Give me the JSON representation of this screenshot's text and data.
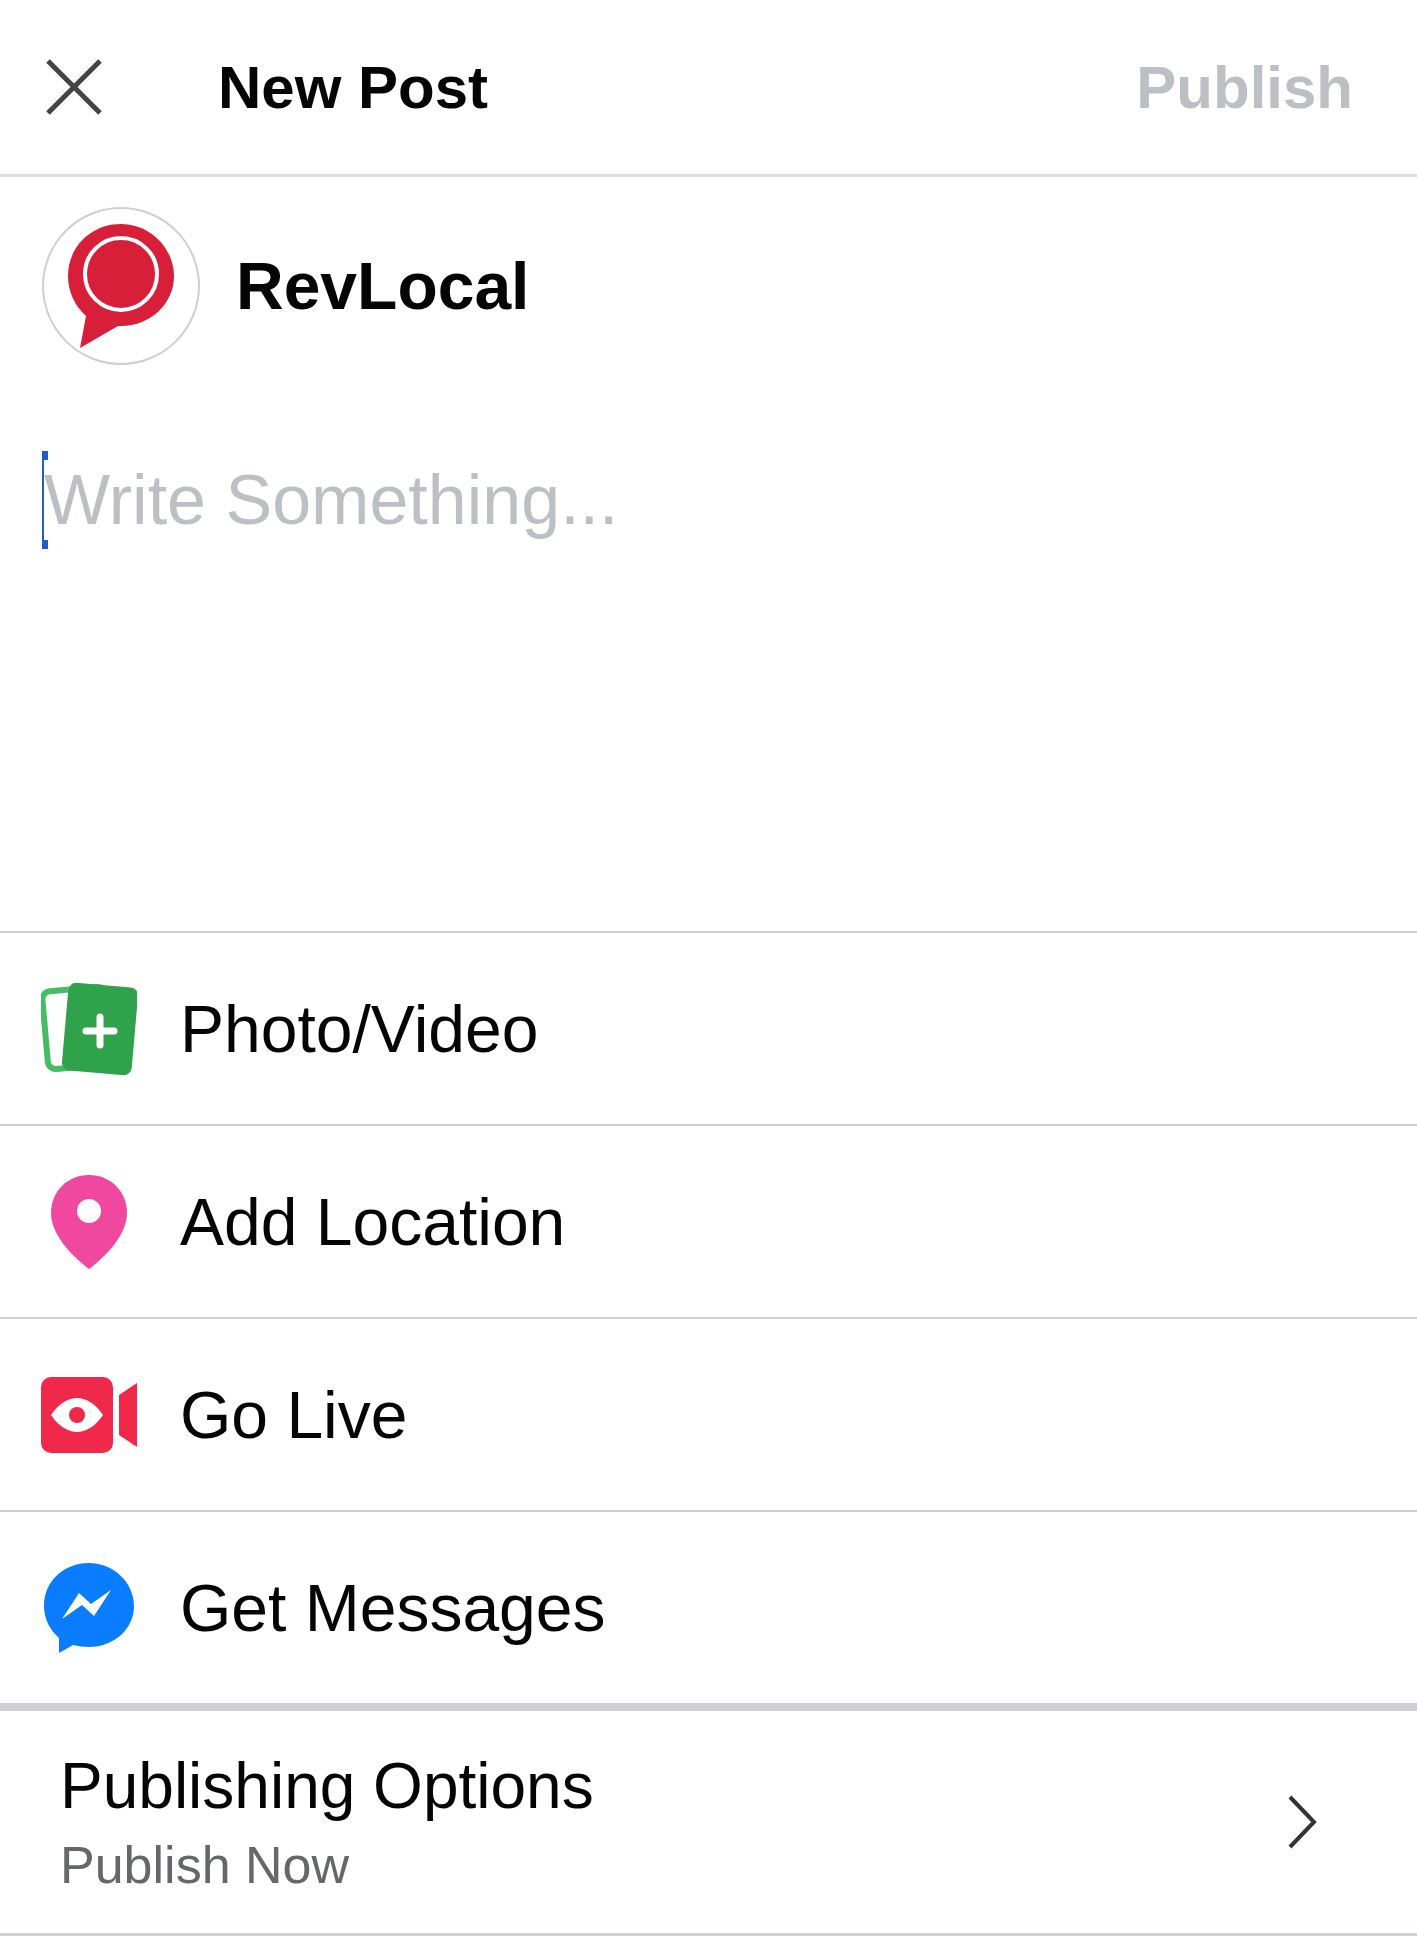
{
  "header": {
    "title": "New Post",
    "publish": {
      "label": "Publish",
      "disabled": true
    }
  },
  "author": {
    "name": "RevLocal"
  },
  "composer": {
    "placeholder": "Write Something...",
    "focused": true
  },
  "actions": [
    {
      "kind": "photo",
      "label": "Photo/Video"
    },
    {
      "kind": "location",
      "label": "Add Location"
    },
    {
      "kind": "live",
      "label": "Go Live"
    },
    {
      "kind": "messages",
      "label": "Get Messages"
    }
  ],
  "publishing": {
    "title": "Publishing Options",
    "value": "Publish Now"
  }
}
